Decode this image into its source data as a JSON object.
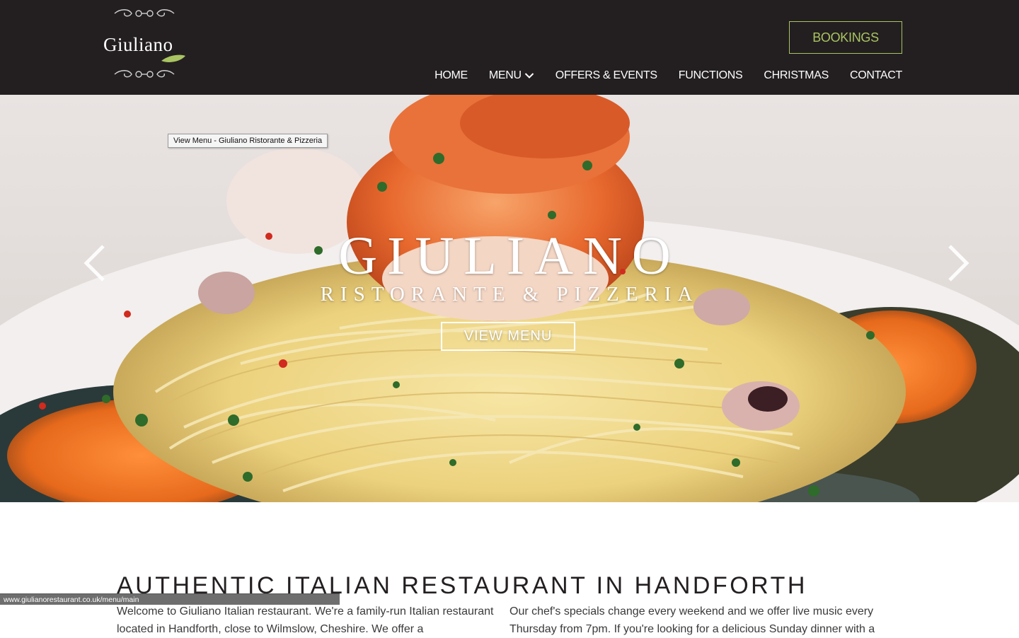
{
  "header": {
    "logo_text": "Giuliano",
    "bookings_label": "BOOKINGS",
    "nav": [
      {
        "label": "HOME"
      },
      {
        "label": "MENU"
      },
      {
        "label": "OFFERS & EVENTS"
      },
      {
        "label": "FUNCTIONS"
      },
      {
        "label": "CHRISTMAS"
      },
      {
        "label": "CONTACT"
      }
    ]
  },
  "hero": {
    "tooltip": "View Menu - Giuliano Ristorante & Pizzeria",
    "title": "GIULIANO",
    "subtitle": "RISTORANTE & PIZZERIA",
    "cta_label": "VIEW MENU",
    "prev_icon": "chevron-left-icon",
    "next_icon": "chevron-right-icon"
  },
  "intro": {
    "heading": "AUTHENTIC ITALIAN RESTAURANT IN HANDFORTH",
    "col_left": "Welcome to Giuliano Italian restaurant. We're a family-run Italian restaurant located in Handforth, close to Wilmslow, Cheshire. We offer a",
    "col_right": "Our chef's specials change every weekend and we offer live music every Thursday from 7pm. If you're looking for a delicious Sunday dinner with a"
  },
  "status_bar": {
    "url": "www.giulianorestaurant.co.uk/menu/main"
  },
  "colors": {
    "header_bg": "#231f20",
    "accent_green": "#a9c462",
    "text_dark": "#231f20"
  }
}
